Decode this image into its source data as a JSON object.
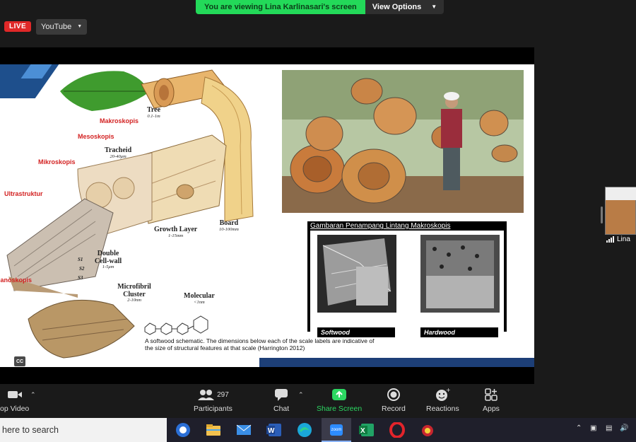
{
  "banner": {
    "viewing_text": "You are viewing Lina Karlinasari's screen",
    "view_options_label": "View Options"
  },
  "live": {
    "badge": "LIVE",
    "platform": "YouTube"
  },
  "slide": {
    "scales": {
      "makroskopis": "Makroskopis",
      "mesoskopis": "Mesoskopis",
      "mikroskopis": "Mikroskopis",
      "ultrastruktur": "Ultrastruktur",
      "nanoskopis": "Nanoskopis"
    },
    "labels": {
      "tree": "Tree",
      "tree_size": "0.1-1m",
      "tracheid": "Tracheid",
      "tracheid_size": "20-40μm",
      "board": "Board",
      "board_size": "10-100mm",
      "growth_layer": "Growth Layer",
      "growth_layer_size": "1-15mm",
      "double_cell_wall": "Double Cell-wall",
      "double_cell_wall_size": "1-5μm",
      "microfibril": "Microfibril Cluster",
      "microfibril_size": "2-10nm",
      "molecular": "Molecular",
      "molecular_size": "<1nm",
      "s1": "S1",
      "s2": "S2",
      "s3": "S3"
    },
    "caption": "A softwood schematic. The dimensions below each of the scale labels are indicative of the size of structural features at that scale (Harrington 2012)",
    "cross_section_title": "Gambaran Penampang Lintang Makroskopis",
    "softwood_label": "Softwood",
    "hardwood_label": "Hardwood"
  },
  "side_panel": {
    "participant_name": "Lina"
  },
  "toolbar": {
    "video_label": "op Video",
    "participants_count": "297",
    "participants_label": "Participants",
    "chat_label": "Chat",
    "share_screen_label": "Share Screen",
    "record_label": "Record",
    "reactions_label": "Reactions",
    "apps_label": "Apps"
  },
  "taskbar": {
    "search_placeholder": "here to search",
    "zoom_label": "zoom"
  },
  "colors": {
    "accent_green": "#2cd862",
    "live_red": "#e02828",
    "slide_scale_red": "#d32222",
    "slide_blue": "#1d3f77"
  }
}
